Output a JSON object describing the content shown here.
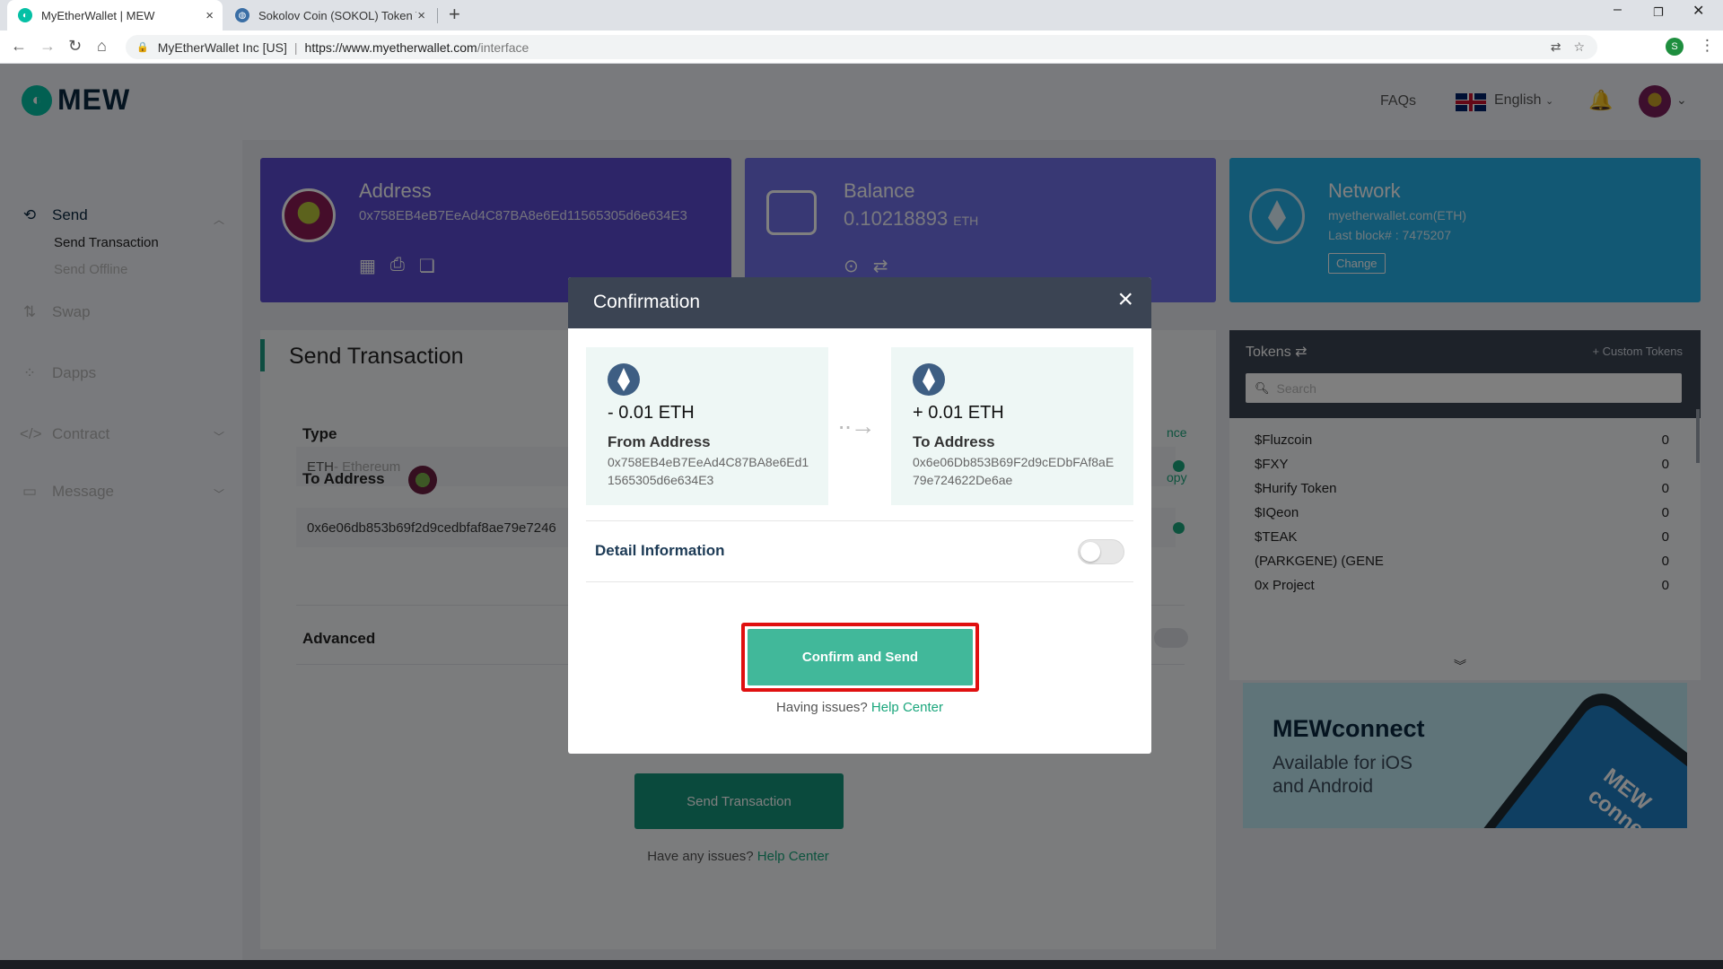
{
  "browser": {
    "tabs": [
      {
        "title": "MyEtherWallet | MEW",
        "active": true
      },
      {
        "title": "Sokolov Coin (SOKOL) Token Trac",
        "active": false
      }
    ],
    "new_tab": "+",
    "close_glyph": "×",
    "org": "MyEtherWallet Inc [US]",
    "url_host": "https://www.myetherwallet.com",
    "url_path": "/interface",
    "profile_initial": "S"
  },
  "header": {
    "logo": "MEW",
    "faqs": "FAQs",
    "language": "English"
  },
  "sidebar": {
    "items": [
      {
        "label": "Send"
      },
      {
        "label": "Swap"
      },
      {
        "label": "Dapps"
      },
      {
        "label": "Contract"
      },
      {
        "label": "Message"
      }
    ],
    "send_sub": [
      {
        "label": "Send Transaction"
      },
      {
        "label": "Send Offline"
      }
    ]
  },
  "cards": {
    "address": {
      "title": "Address",
      "value": "0x758EB4eB7EeAd4C87BA8e6Ed11565305d6e634E3"
    },
    "balance": {
      "title": "Balance",
      "amount": "0.10218893",
      "unit": "ETH"
    },
    "network": {
      "title": "Network",
      "name": "myetherwallet.com(ETH)",
      "last_block": "Last block# : 7475207",
      "change": "Change"
    }
  },
  "send_form": {
    "title": "Send Transaction",
    "type_label": "Type",
    "type_value": "ETH",
    "type_desc": " - Ethereum",
    "to_label": "To Address",
    "to_value": "0x6e06db853b69f2d9cedbfaf8ae79e7246",
    "advanced_label": "Advanced",
    "send_button": "Send Transaction",
    "help_text": "Have any issues?",
    "help_link": "Help Center",
    "link_1": "nce",
    "link_2": "opy"
  },
  "tokens": {
    "title": "Tokens",
    "custom": "+ Custom Tokens",
    "search_placeholder": "Search",
    "items": [
      {
        "name": "$Fluzcoin",
        "balance": "0"
      },
      {
        "name": "$FXY",
        "balance": "0"
      },
      {
        "name": "$Hurify Token",
        "balance": "0"
      },
      {
        "name": "$IQeon",
        "balance": "0"
      },
      {
        "name": "$TEAK",
        "balance": "0"
      },
      {
        "name": "(PARKGENE) (GENE",
        "balance": "0"
      },
      {
        "name": "0x Project",
        "balance": "0"
      }
    ]
  },
  "promo": {
    "title": "MEWconnect",
    "line1": "Available for iOS",
    "line2": "and Android",
    "phone_text": "MEW connect"
  },
  "modal": {
    "title": "Confirmation",
    "from": {
      "amount": "- 0.01",
      "unit": "ETH",
      "label": "From Address",
      "address": "0x758EB4eB7EeAd4C87BA8e6Ed11565305d6e634E3"
    },
    "to": {
      "amount": "+ 0.01",
      "unit": "ETH",
      "label": "To Address",
      "address": "0x6e06Db853B69F2d9cEDbFAf8aE79e724622De6ae"
    },
    "detail_label": "Detail Information",
    "detail_enabled": false,
    "confirm_button": "Confirm and Send",
    "help_text": "Having issues?",
    "help_link": "Help Center"
  },
  "colors": {
    "accent": "#41b89a",
    "highlight": "#e01010",
    "modal_header": "#3b4453"
  }
}
